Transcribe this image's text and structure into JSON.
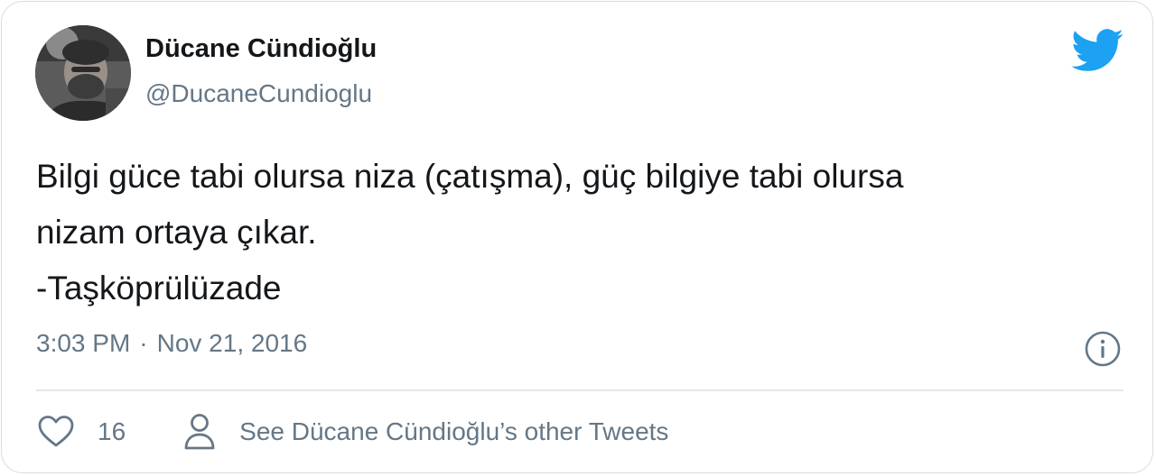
{
  "author": {
    "display_name": "Dücane Cündioğlu",
    "handle": "@DucaneCundioglu"
  },
  "tweet": {
    "lines": [
      "Bilgi güce tabi olursa niza (çatışma), güç bilgiye tabi olursa",
      "nizam ortaya çıkar.",
      "-Taşköprülüzade"
    ],
    "time": "3:03 PM",
    "separator": "·",
    "date": "Nov 21, 2016"
  },
  "actions": {
    "like_count": "16",
    "see_other_label": "See Dücane Cündioğlu’s other Tweets"
  },
  "colors": {
    "twitter_blue": "#1da1f2",
    "text_primary": "#14171a",
    "text_secondary": "#657786",
    "divider": "#e1e8ed"
  },
  "icons": {
    "brand": "twitter-bird-icon",
    "info": "info-icon",
    "like": "heart-icon",
    "profile": "person-icon"
  }
}
